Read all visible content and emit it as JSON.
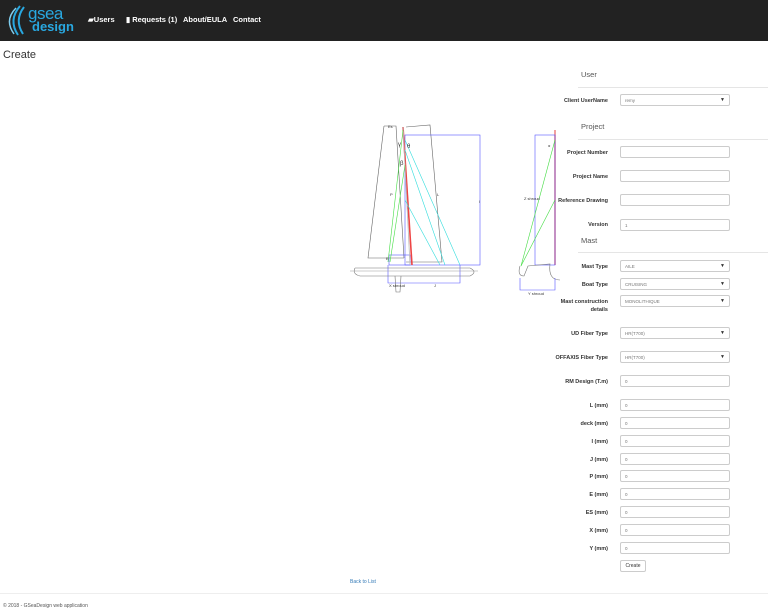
{
  "nav": {
    "logo_top": "gsea",
    "logo_bottom": "design",
    "items": [
      {
        "label": "Users",
        "icon": "folder-open-icon"
      },
      {
        "label": "Requests (1)",
        "icon": "file-icon"
      },
      {
        "label": "About/EULA"
      },
      {
        "label": "Contact"
      }
    ]
  },
  "page": {
    "title": "Create"
  },
  "diagram": {
    "labels": {
      "e": "E",
      "p": "P",
      "l": "L",
      "i": "I",
      "j": "J",
      "x_shroud": "X shroud",
      "z_shroud": "Z shroud",
      "y_shroud": "Y shroud",
      "gamma": "γ",
      "theta": "θ",
      "beta": "β",
      "alpha": "α",
      "es": "Es"
    }
  },
  "form": {
    "sections": {
      "user": "User",
      "project": "Project",
      "mast": "Mast"
    },
    "client": {
      "label": "Client UserName",
      "value": "remy"
    },
    "project_number": {
      "label": "Project Number",
      "value": ""
    },
    "project_name": {
      "label": "Project Name",
      "value": ""
    },
    "reference_drawing": {
      "label": "Reference Drawing",
      "value": ""
    },
    "version": {
      "label": "Version",
      "value": "1"
    },
    "mast_type": {
      "label": "Mast Type",
      "value": "AILE"
    },
    "boat_type": {
      "label": "Boat Type",
      "value": "CRUISING"
    },
    "mast_construction": {
      "label": "Mast construction details",
      "value": "MONOLITHIQUE"
    },
    "ud_fiber": {
      "label": "UD Fiber Type",
      "value": "HR(T700)"
    },
    "offaxis_fiber": {
      "label": "OFFAXIS Fiber Type",
      "value": "HR(T700)"
    },
    "rm_design": {
      "label": "RM Design (T.m)",
      "value": "0"
    },
    "l": {
      "label": "L (mm)",
      "value": "0"
    },
    "deck": {
      "label": "deck (mm)",
      "value": "0"
    },
    "i": {
      "label": "I (mm)",
      "value": "0"
    },
    "j": {
      "label": "J (mm)",
      "value": "0"
    },
    "p": {
      "label": "P (mm)",
      "value": "0"
    },
    "e": {
      "label": "E (mm)",
      "value": "0"
    },
    "es": {
      "label": "ES (mm)",
      "value": "0"
    },
    "x": {
      "label": "X (mm)",
      "value": "0"
    },
    "y": {
      "label": "Y (mm)",
      "value": "0"
    },
    "create": "Create"
  },
  "back_link": "Back to List",
  "footer": "© 2018 - GSeaDesign web application"
}
